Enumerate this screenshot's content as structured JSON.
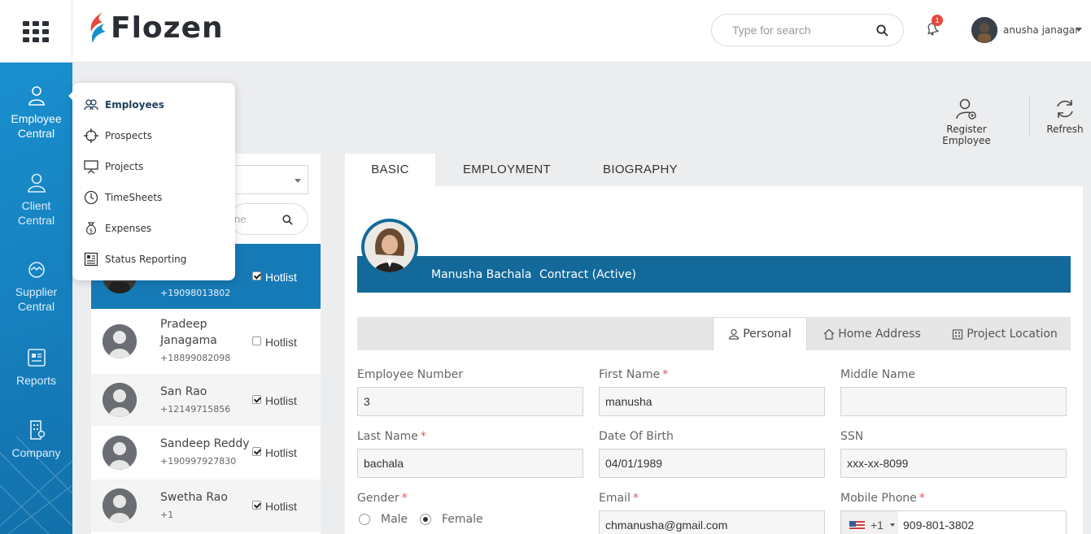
{
  "app": {
    "logo_text": "Flozen"
  },
  "header": {
    "search_placeholder": "Type for search",
    "notification_count": "1",
    "user_name": "anusha janagar"
  },
  "sidebar": {
    "items": [
      {
        "label_line1": "Employee",
        "label_line2": "Central",
        "icon": "user-icon"
      },
      {
        "label_line1": "Client",
        "label_line2": "Central",
        "icon": "client-icon"
      },
      {
        "label_line1": "Supplier",
        "label_line2": "Central",
        "icon": "supplier-icon"
      },
      {
        "label_line1": "Reports",
        "label_line2": "",
        "icon": "reports-icon"
      },
      {
        "label_line1": "Company",
        "label_line2": "",
        "icon": "company-icon"
      }
    ]
  },
  "menu": {
    "items": [
      {
        "label": "Employees",
        "icon": "people-icon"
      },
      {
        "label": "Prospects",
        "icon": "crosshair-icon"
      },
      {
        "label": "Projects",
        "icon": "presentation-icon"
      },
      {
        "label": "TimeSheets",
        "icon": "clock-icon"
      },
      {
        "label": "Expenses",
        "icon": "money-bag-icon"
      },
      {
        "label": "Status Reporting",
        "icon": "report-icon"
      }
    ]
  },
  "list": {
    "search_placeholder_visible": "ne",
    "hotlist_label": "Hotlist",
    "employees": [
      {
        "name": "",
        "phone": "+19098013802",
        "hotlist": true
      },
      {
        "name": "Pradeep Janagama",
        "phone": "+18899082098",
        "hotlist": false
      },
      {
        "name": "San Rao",
        "phone": "+12149715856",
        "hotlist": true
      },
      {
        "name": "Sandeep Reddy",
        "phone": "+190997927830",
        "hotlist": true
      },
      {
        "name": "Swetha Rao",
        "phone": "+1",
        "hotlist": true
      }
    ]
  },
  "actions": {
    "register": "Register Employee",
    "refresh": "Refresh"
  },
  "tabs": [
    "BASIC",
    "EMPLOYMENT",
    "BIOGRAPHY"
  ],
  "profile": {
    "name": "Manusha Bachala",
    "status": "Contract (Active)"
  },
  "subtabs": [
    "Personal",
    "Home Address",
    "Project Location"
  ],
  "form": {
    "employee_number": {
      "label": "Employee Number",
      "value": "3"
    },
    "first_name": {
      "label": "First Name",
      "value": "manusha",
      "required": "*"
    },
    "middle_name": {
      "label": "Middle Name",
      "value": ""
    },
    "last_name": {
      "label": "Last Name",
      "value": "bachala",
      "required": "*"
    },
    "dob": {
      "label": "Date Of Birth",
      "value": "04/01/1989"
    },
    "ssn": {
      "label": "SSN",
      "value": "xxx-xx-8099"
    },
    "gender": {
      "label": "Gender",
      "required": "*",
      "options": [
        "Male",
        "Female"
      ],
      "selected": "Female"
    },
    "email": {
      "label": "Email",
      "value": "chmanusha@gmail.com",
      "required": "*"
    },
    "mobile": {
      "label": "Mobile Phone",
      "required": "*",
      "country_code": "+1",
      "value": "909-801-3802"
    }
  },
  "colors": {
    "primary": "#167ab6",
    "banner": "#12699a",
    "required": "#e05656"
  }
}
